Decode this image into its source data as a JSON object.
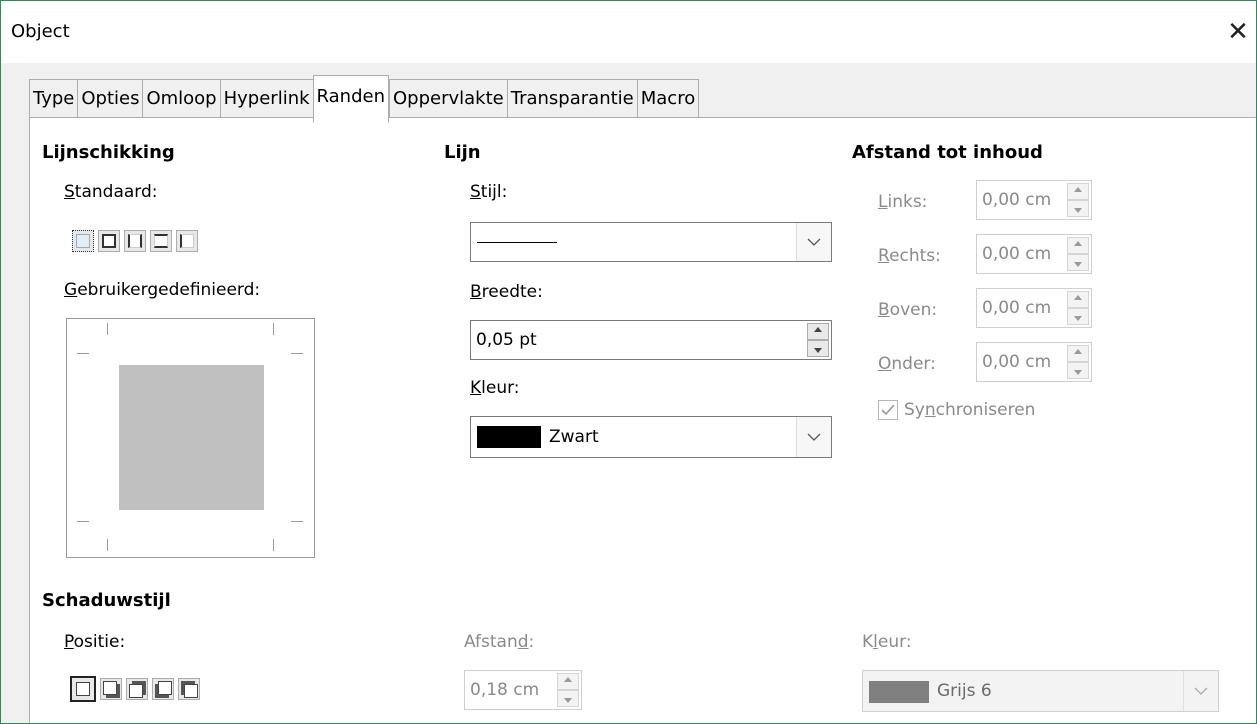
{
  "window": {
    "title": "Object"
  },
  "tabs": [
    {
      "label": "Type"
    },
    {
      "label": "Opties"
    },
    {
      "label": "Omloop"
    },
    {
      "label": "Hyperlink"
    },
    {
      "label": "Randen",
      "active": true
    },
    {
      "label": "Oppervlakte"
    },
    {
      "label": "Transparantie"
    },
    {
      "label": "Macro"
    }
  ],
  "line_arrangement": {
    "heading": "Lijnschikking",
    "default_label_u": "S",
    "default_label_rest": "tandaard:",
    "custom_label_u": "G",
    "custom_label_rest": "ebruikergedefinieerd:"
  },
  "line": {
    "heading": "Lijn",
    "style_label_u": "S",
    "style_label_rest": "tijl:",
    "width_label_u": "B",
    "width_label_rest": "reedte:",
    "width_value": "0,05 pt",
    "color_label_u": "K",
    "color_label_rest": "leur:",
    "color_value": "Zwart",
    "color_swatch": "#000000"
  },
  "padding": {
    "heading": "Afstand tot inhoud",
    "left_u": "L",
    "left_rest": "inks:",
    "left_value": "0,00 cm",
    "right_u": "R",
    "right_rest": "echts:",
    "right_value": "0,00 cm",
    "top_u": "B",
    "top_rest": "oven:",
    "top_value": "0,00 cm",
    "bottom_u": "O",
    "bottom_rest": "nder:",
    "bottom_value": "0,00 cm",
    "sync_pre": "Sy",
    "sync_u": "n",
    "sync_rest": "chroniseren"
  },
  "shadow": {
    "heading": "Schaduwstijl",
    "position_u": "P",
    "position_rest": "ositie:",
    "distance_pre": "Afstan",
    "distance_u": "d",
    "distance_rest": ":",
    "distance_value": "0,18 cm",
    "color_pre": "K",
    "color_u": "l",
    "color_rest": "eur:",
    "color_value": "Grijs 6",
    "color_swatch": "#808080"
  },
  "colors": {
    "accent_border": "#2e8b57",
    "preview_fill": "#c0c0c0"
  }
}
